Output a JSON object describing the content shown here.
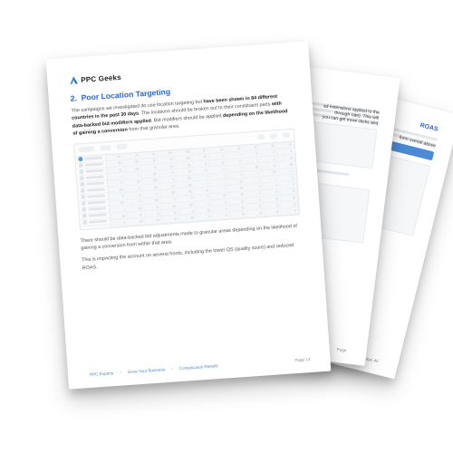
{
  "brand": {
    "name": "PPC Geeks"
  },
  "front": {
    "heading_no": "2.",
    "heading": "Poor Location Targeting",
    "para1_a": "The campaigns we investigated do use location targeting but ",
    "para1_b": "have been shown in 84 different countries in the past 30 days",
    "para1_c": ". The locations should be broken out to their constituent parts ",
    "para1_d": "with data-backed bid modifiers applied",
    "para1_e": ". Bid modifiers should be applied ",
    "para1_f": "depending on the likelihood of gaining a conversion",
    "para1_g": " from that granular area.",
    "para2": "There should be data-backed bid adjustments made to granular areas depending on the likelihood of gaining a conversion from within that area.",
    "para3": "This is impacting the account on several fronts, including the lower QS (quality score) and reduced ROAS.",
    "page_label": "Page 14"
  },
  "mid": {
    "snippet1": "ad extensions applied to the",
    "snippet2": "through rate). This will",
    "snippet3": "you can get more clicks and",
    "page_label": "Page"
  },
  "back": {
    "title_tail": "ROAS",
    "snippet": "form overall above",
    "page_label": "Page 40"
  },
  "footer_links": {
    "a": "PPC Experts",
    "b": "Grow Your Business",
    "c": "Conspicuous Results"
  }
}
